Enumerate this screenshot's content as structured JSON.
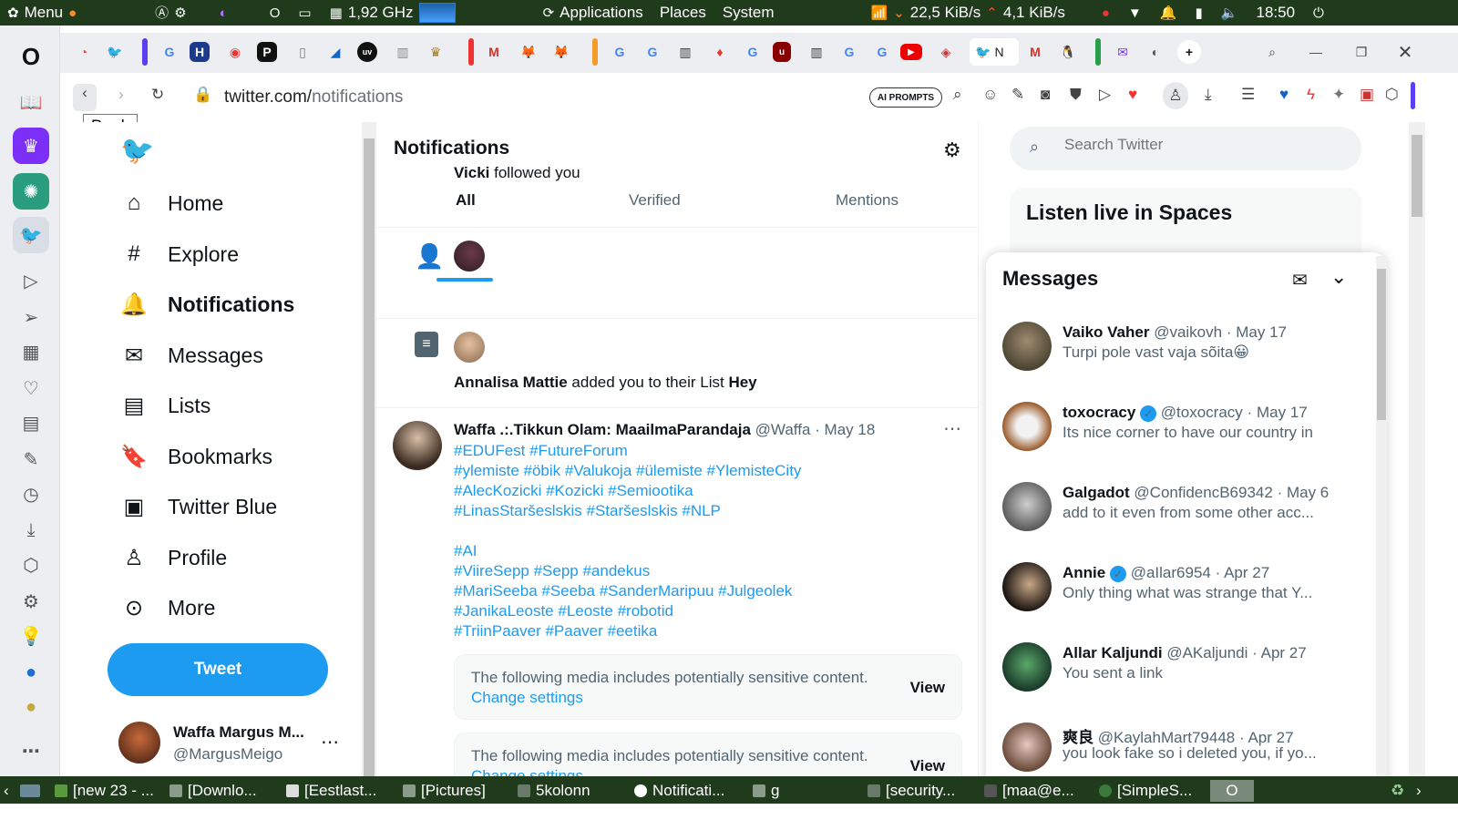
{
  "system_panel": {
    "menu_label": "Menu",
    "cpu": "1,92 GHz",
    "places": [
      "Applications",
      "Places",
      "System"
    ],
    "net_down": "22,5 KiB/s",
    "net_up": "4,1 KiB/s",
    "clock": "18:50"
  },
  "browser": {
    "url_host": "twitter.com/",
    "url_path": "notifications",
    "ai_prompts_label": "AI PROMPTS",
    "back_tooltip": "Back",
    "active_tab_label": "N"
  },
  "nav": {
    "items": [
      {
        "label": "Home",
        "icon": "home-icon"
      },
      {
        "label": "Explore",
        "icon": "hashtag-icon"
      },
      {
        "label": "Notifications",
        "icon": "bell-icon",
        "active": true
      },
      {
        "label": "Messages",
        "icon": "envelope-icon"
      },
      {
        "label": "Lists",
        "icon": "list-icon"
      },
      {
        "label": "Bookmarks",
        "icon": "bookmark-icon"
      },
      {
        "label": "Twitter Blue",
        "icon": "twitter-blue-icon"
      },
      {
        "label": "Profile",
        "icon": "person-icon"
      },
      {
        "label": "More",
        "icon": "more-circle-icon"
      }
    ],
    "tweet_button": "Tweet",
    "user_name": "Waffa Margus M...",
    "user_handle": "@MargusMeigo"
  },
  "notifications": {
    "title": "Notifications",
    "tabs": [
      "All",
      "Verified",
      "Mentions"
    ],
    "follow": {
      "name": "Vicki",
      "action": " followed you"
    },
    "list_add": {
      "name": "Annalisa Mattie",
      "action": " added you to their List ",
      "list": "Hey"
    },
    "tweet": {
      "author": "Waffa .:.Tikkun Olam: MaailmaParandaja",
      "handle": "@Waffa",
      "date": "May 18",
      "lines": [
        "#EDUFest #FutureForum",
        "#ylemiste #öbik #Valukoja #ülemiste #YlemisteCity",
        "#AlecKozicki #Kozicki #Semiootika",
        "#LinasStaršeslskis #Staršeslskis #NLP",
        "",
        "#AI",
        "#ViireSepp #Sepp #andekus",
        "#MariSeeba #Seeba #SanderMaripuu #Julgeolek",
        "#JanikaLeoste #Leoste #robotid",
        "#TriinPaaver #Paaver #eetika"
      ],
      "sensitive_text": "The following media includes potentially sensitive content.",
      "change_settings": "Change settings",
      "view": "View"
    }
  },
  "right": {
    "search_placeholder": "Search Twitter",
    "spaces_title": "Listen live in Spaces"
  },
  "messages": {
    "title": "Messages",
    "items": [
      {
        "name": "Vaiko Vaher",
        "verified": false,
        "handle": "@vaikovh",
        "date": "May 17",
        "text": "Turpi pole vast vaja sõita😀"
      },
      {
        "name": "toxocracy",
        "verified": true,
        "handle": "@toxocracy",
        "date": "May 17",
        "text": "Its nice corner to have our country in"
      },
      {
        "name": "Galgadot",
        "verified": false,
        "handle": "@ConfidencB69342",
        "date": "May 6",
        "text": "add to it even from some other acc..."
      },
      {
        "name": "Annie",
        "verified": true,
        "handle": "@aIlar6954",
        "date": "Apr 27",
        "text": "Only thing what was strange that Y..."
      },
      {
        "name": "Allar Kaljundi",
        "verified": false,
        "handle": "@AKaljundi",
        "date": "Apr 27",
        "text": "You sent a link"
      },
      {
        "name": "爽良",
        "verified": false,
        "handle": "@KaylahMart79448",
        "date": "Apr 27",
        "text": "you look fake so i deleted you, if yo..."
      }
    ]
  },
  "taskbar": {
    "tasks": [
      "[new 23 - ...",
      "[Downlo...",
      "[Eestlast...",
      "[Pictures]",
      "5kolonn",
      "Notificati...",
      "g",
      "[security...",
      "[maa@e...",
      "[SimpleS..."
    ]
  },
  "colors": {
    "accent": "#1d9bf0",
    "panel": "#1f3b1c"
  }
}
